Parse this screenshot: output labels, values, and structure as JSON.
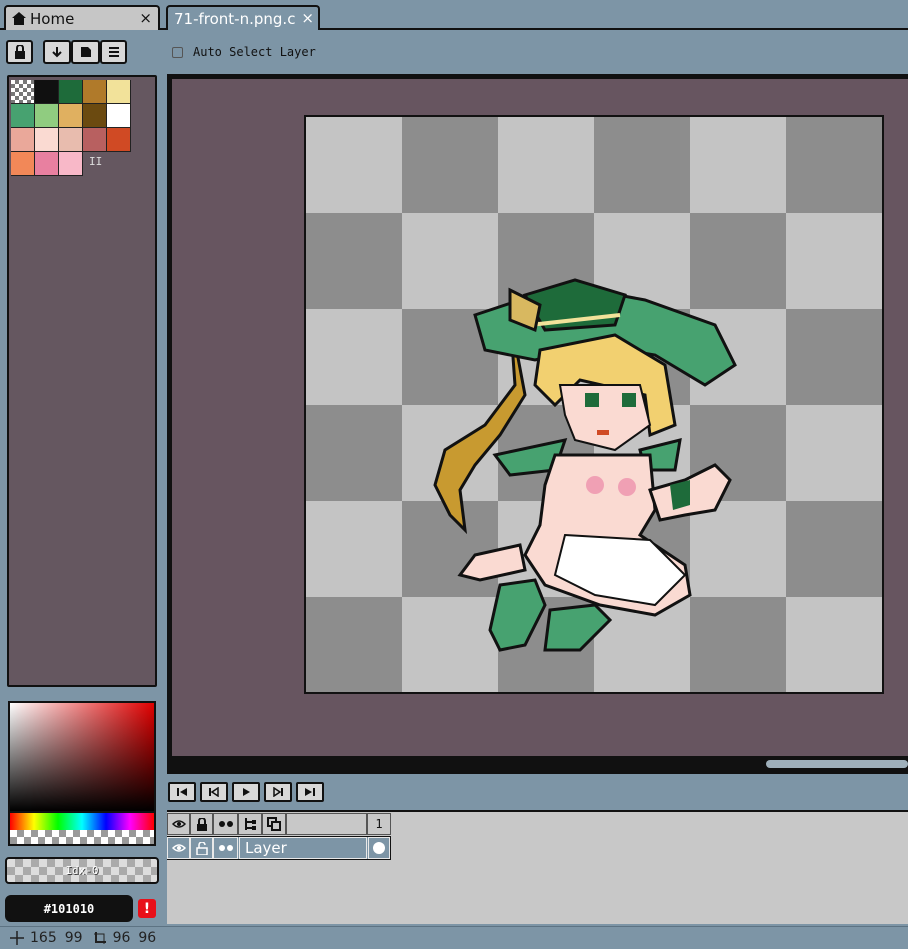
{
  "tabs": [
    {
      "label": "Home",
      "icon": "home-icon",
      "close": "×"
    },
    {
      "label": "71-front-n.png.c",
      "close": "×"
    }
  ],
  "toolbar": {
    "auto_select_label": "Auto Select Layer",
    "auto_select_checked": false
  },
  "palette": {
    "colors": [
      "transparent",
      "#101010",
      "#1e6b3a",
      "#b07a2a",
      "#f2e29a",
      "#47a270",
      "#90cc80",
      "#e0b060",
      "#6b4a10",
      "#ffffff",
      "#eaa89a",
      "#fadad2",
      "#e8bcae",
      "#b86060",
      "#d04a24",
      "#f28858",
      "#e880a0",
      "#f8b8c8"
    ],
    "extra_mark": "II"
  },
  "color_picker": {
    "index_label": "Idx-0",
    "hex_value": "#101010",
    "warning_symbol": "!"
  },
  "timeline": {
    "buttons": [
      "first-frame",
      "prev-frame",
      "play",
      "next-frame",
      "last-frame"
    ],
    "frame_number": "1"
  },
  "layers": [
    {
      "name": "Layer",
      "visible": true,
      "locked": false
    }
  ],
  "status": {
    "cursor_x": "165",
    "cursor_y": "99",
    "sprite_w": "96",
    "sprite_h": "96"
  }
}
